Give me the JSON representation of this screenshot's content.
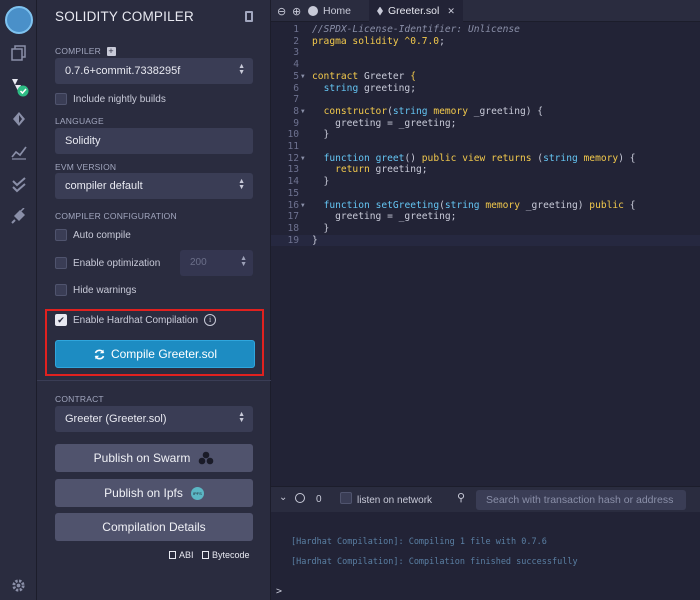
{
  "sidebar_icons": [
    "remix-logo-icon",
    "file-explorer-icon",
    "solidity-compiler-icon",
    "deploy-run-icon",
    "analysis-icon",
    "testing-icon",
    "plugin-manager-icon",
    "settings-icon"
  ],
  "panel": {
    "title": "SOLIDITY COMPILER",
    "compiler_label": "COMPILER",
    "compiler_value": "0.7.6+commit.7338295f",
    "nightly_label": "Include nightly builds",
    "language_label": "LANGUAGE",
    "language_value": "Solidity",
    "evm_label": "EVM VERSION",
    "evm_value": "compiler default",
    "config_label": "COMPILER CONFIGURATION",
    "auto_compile": "Auto compile",
    "enable_optimization": "Enable optimization",
    "runs_value": "200",
    "hide_warnings": "Hide warnings",
    "hardhat": "Enable Hardhat Compilation",
    "compile_button": "Compile Greeter.sol",
    "contract_label": "CONTRACT",
    "contract_value": "Greeter (Greeter.sol)",
    "publish_swarm": "Publish on Swarm",
    "publish_ipfs": "Publish on Ipfs",
    "ipfs_badge": "IPFS",
    "compilation_details": "Compilation Details",
    "abi": "ABI",
    "bytecode": "Bytecode"
  },
  "tabs": {
    "home": "Home",
    "file": "Greeter.sol",
    "close": "✕"
  },
  "editor": {
    "lines": [
      {
        "n": "1",
        "html": "<span class='c'>//SPDX-License-Identifier: Unlicense</span>"
      },
      {
        "n": "2",
        "html": "<span class='k'>pragma solidity</span> <span class='k'>^0.7.0</span>;"
      },
      {
        "n": "3",
        "html": ""
      },
      {
        "n": "4",
        "html": ""
      },
      {
        "n": "5",
        "html": "<span class='k'>contract</span> Greeter <span class='k'>{</span>",
        "fold": true
      },
      {
        "n": "6",
        "html": "  <span class='t'>string</span> greeting;"
      },
      {
        "n": "7",
        "html": ""
      },
      {
        "n": "8",
        "html": "  <span class='k'>constructor</span>(<span class='t'>string</span> <span class='k'>memory</span> _greeting) {",
        "fold": true
      },
      {
        "n": "9",
        "html": "    greeting = _greeting;"
      },
      {
        "n": "10",
        "html": "  }"
      },
      {
        "n": "11",
        "html": ""
      },
      {
        "n": "12",
        "html": "  <span class='t'>function</span> <span class='f'>greet</span>() <span class='k'>public view returns</span> (<span class='t'>string</span> <span class='k'>memory</span>) {",
        "fold": true
      },
      {
        "n": "13",
        "html": "    <span class='k'>return</span> greeting;"
      },
      {
        "n": "14",
        "html": "  }"
      },
      {
        "n": "15",
        "html": ""
      },
      {
        "n": "16",
        "html": "  <span class='t'>function</span> <span class='f'>setGreeting</span>(<span class='t'>string</span> <span class='k'>memory</span> _greeting) <span class='k'>public</span> {",
        "fold": true
      },
      {
        "n": "17",
        "html": "    greeting = _greeting;"
      },
      {
        "n": "18",
        "html": "  }"
      },
      {
        "n": "19",
        "html": "}"
      }
    ]
  },
  "terminal": {
    "count": "0",
    "listen_label": "listen on network",
    "search_placeholder": "Search with transaction hash or address",
    "messages": [
      "[Hardhat Compilation]: Compiling 1 file with 0.7.6",
      "[Hardhat Compilation]: Compilation finished successfully"
    ],
    "prompt": ">"
  }
}
